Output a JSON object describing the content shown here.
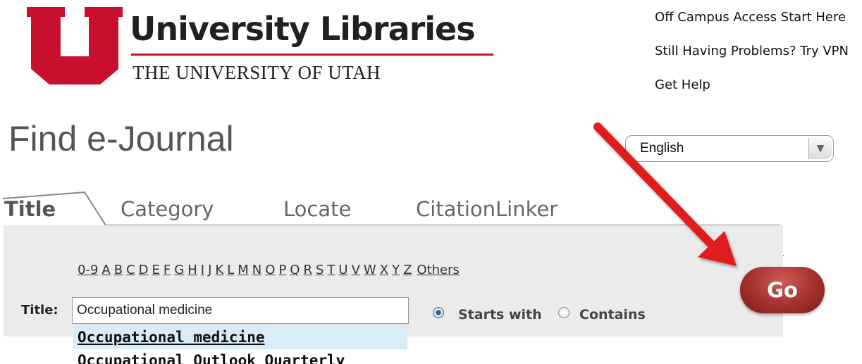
{
  "header": {
    "brand_title": "University Libraries",
    "brand_subtitle": "THE UNIVERSITY OF UTAH",
    "brand_color": "#c8102e"
  },
  "top_links": {
    "off_campus": "Off Campus Access Start Here",
    "vpn": "Still Having Problems? Try VPN",
    "help": "Get Help"
  },
  "page_title": "Find e-Journal",
  "language": {
    "selected": "English"
  },
  "tabs": [
    {
      "label": "Title",
      "active": true
    },
    {
      "label": "Category"
    },
    {
      "label": "Locate"
    },
    {
      "label": "CitationLinker"
    }
  ],
  "alphabet": [
    "0-9",
    "A",
    "B",
    "C",
    "D",
    "E",
    "F",
    "G",
    "H",
    "I",
    "J",
    "K",
    "L",
    "M",
    "N",
    "O",
    "P",
    "Q",
    "R",
    "S",
    "T",
    "U",
    "V",
    "W",
    "X",
    "Y",
    "Z",
    "Others"
  ],
  "search": {
    "title_label": "Title:",
    "title_value": "Occupational medicine",
    "match_options": [
      {
        "label": "Starts with",
        "checked": true
      },
      {
        "label": "Contains",
        "checked": false
      }
    ],
    "go_label": "Go"
  },
  "autocomplete": {
    "items": [
      "Occupational medicine",
      "Occupational Outlook Quarterly"
    ]
  },
  "annotation": {
    "arrow_color": "#e01b1b",
    "arrow_target": "go-button"
  }
}
